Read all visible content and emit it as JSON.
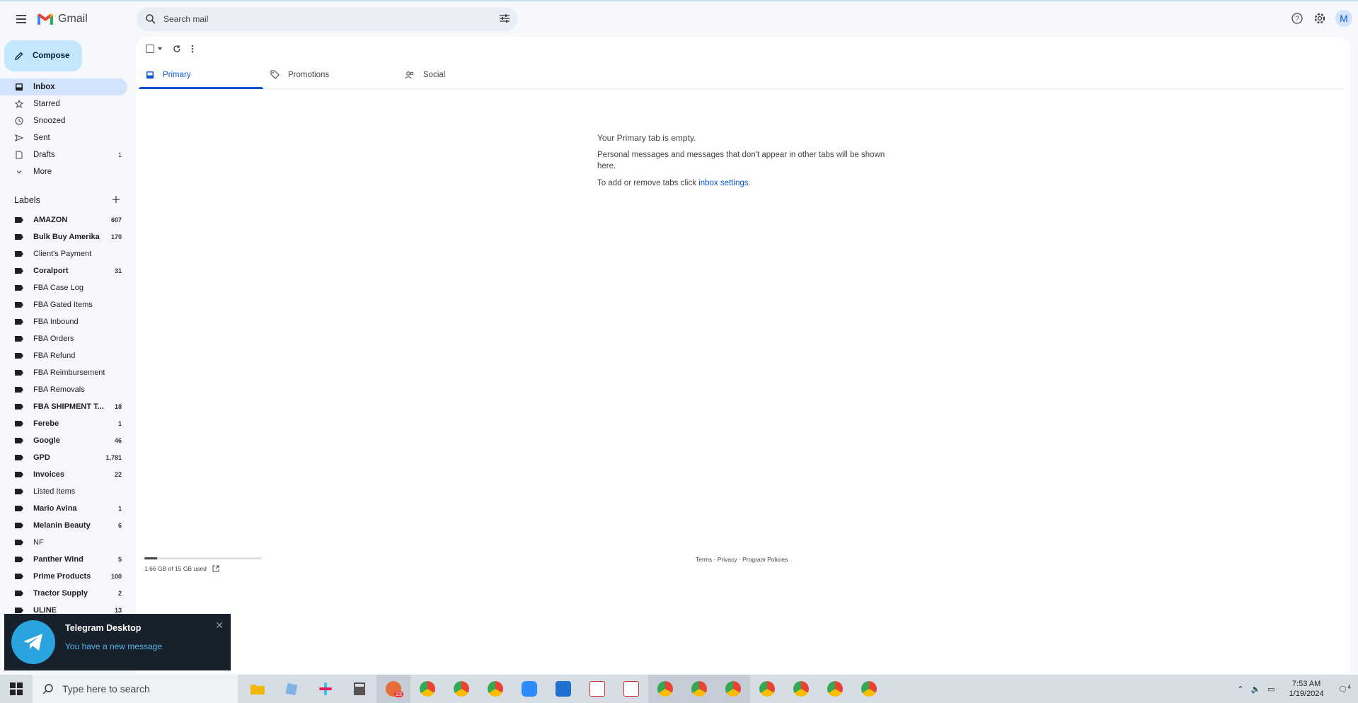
{
  "app": {
    "name": "Gmail"
  },
  "search": {
    "placeholder": "Search mail"
  },
  "header": {
    "avatar_letter": "M"
  },
  "compose": {
    "label": "Compose"
  },
  "nav": [
    {
      "label": "Inbox",
      "icon": "inbox-icon",
      "count": ""
    },
    {
      "label": "Starred",
      "icon": "star-icon",
      "count": ""
    },
    {
      "label": "Snoozed",
      "icon": "clock-icon",
      "count": ""
    },
    {
      "label": "Sent",
      "icon": "send-icon",
      "count": ""
    },
    {
      "label": "Drafts",
      "icon": "draft-icon",
      "count": "1"
    },
    {
      "label": "More",
      "icon": "chevron-down-icon",
      "count": ""
    }
  ],
  "labels_header": "Labels",
  "labels": [
    {
      "label": "AMAZON",
      "count": "607",
      "bold": true
    },
    {
      "label": "Bulk Buy Amerika",
      "count": "170",
      "bold": true
    },
    {
      "label": "Client's Payment",
      "count": "",
      "bold": false
    },
    {
      "label": "Coralport",
      "count": "31",
      "bold": true
    },
    {
      "label": "FBA Case Log",
      "count": "",
      "bold": false
    },
    {
      "label": "FBA Gated Items",
      "count": "",
      "bold": false
    },
    {
      "label": "FBA Inbound",
      "count": "",
      "bold": false
    },
    {
      "label": "FBA Orders",
      "count": "",
      "bold": false
    },
    {
      "label": "FBA Refund",
      "count": "",
      "bold": false
    },
    {
      "label": "FBA Reimbursement",
      "count": "",
      "bold": false
    },
    {
      "label": "FBA Removals",
      "count": "",
      "bold": false
    },
    {
      "label": "FBA SHIPMENT T...",
      "count": "18",
      "bold": true
    },
    {
      "label": "Ferebe",
      "count": "1",
      "bold": true
    },
    {
      "label": "Google",
      "count": "46",
      "bold": true
    },
    {
      "label": "GPD",
      "count": "1,781",
      "bold": true
    },
    {
      "label": "Invoices",
      "count": "22",
      "bold": true
    },
    {
      "label": "Listed Items",
      "count": "",
      "bold": false
    },
    {
      "label": "Mario Avina",
      "count": "1",
      "bold": true
    },
    {
      "label": "Melanin Beauty",
      "count": "6",
      "bold": true
    },
    {
      "label": "NF",
      "count": "",
      "bold": false
    },
    {
      "label": "Panther Wind",
      "count": "5",
      "bold": true
    },
    {
      "label": "Prime Products",
      "count": "100",
      "bold": true
    },
    {
      "label": "Tractor Supply",
      "count": "2",
      "bold": true
    },
    {
      "label": "ULINE",
      "count": "13",
      "bold": true
    }
  ],
  "tabs": [
    {
      "label": "Primary",
      "icon": "inbox-icon",
      "active": true
    },
    {
      "label": "Promotions",
      "icon": "tag-icon",
      "active": false
    },
    {
      "label": "Social",
      "icon": "people-icon",
      "active": false
    }
  ],
  "empty_state": {
    "title": "Your Primary tab is empty.",
    "body": "Personal messages and messages that don't appear in other tabs will be shown here.",
    "settings_prefix": "To add or remove tabs click ",
    "settings_link": "inbox settings",
    "settings_suffix": "."
  },
  "storage": {
    "text": "1.66 GB of 15 GB used",
    "fraction": 0.11
  },
  "footer": {
    "terms": "Terms",
    "privacy": "Privacy",
    "policies": "Program Policies",
    "sep": " · "
  },
  "toast": {
    "title": "Telegram Desktop",
    "message": "You have a new message"
  },
  "taskbar": {
    "search_placeholder": "Type here to search",
    "time": "7:53 AM",
    "date": "1/19/2024",
    "notification_count": "4",
    "telegram_badge": "23"
  },
  "colors": {
    "accent": "#0b57d0",
    "compose_bg": "#c2e7ff",
    "active_nav": "#d3e3fd",
    "toast_bg": "#17212b",
    "telegram": "#2aa3df"
  }
}
